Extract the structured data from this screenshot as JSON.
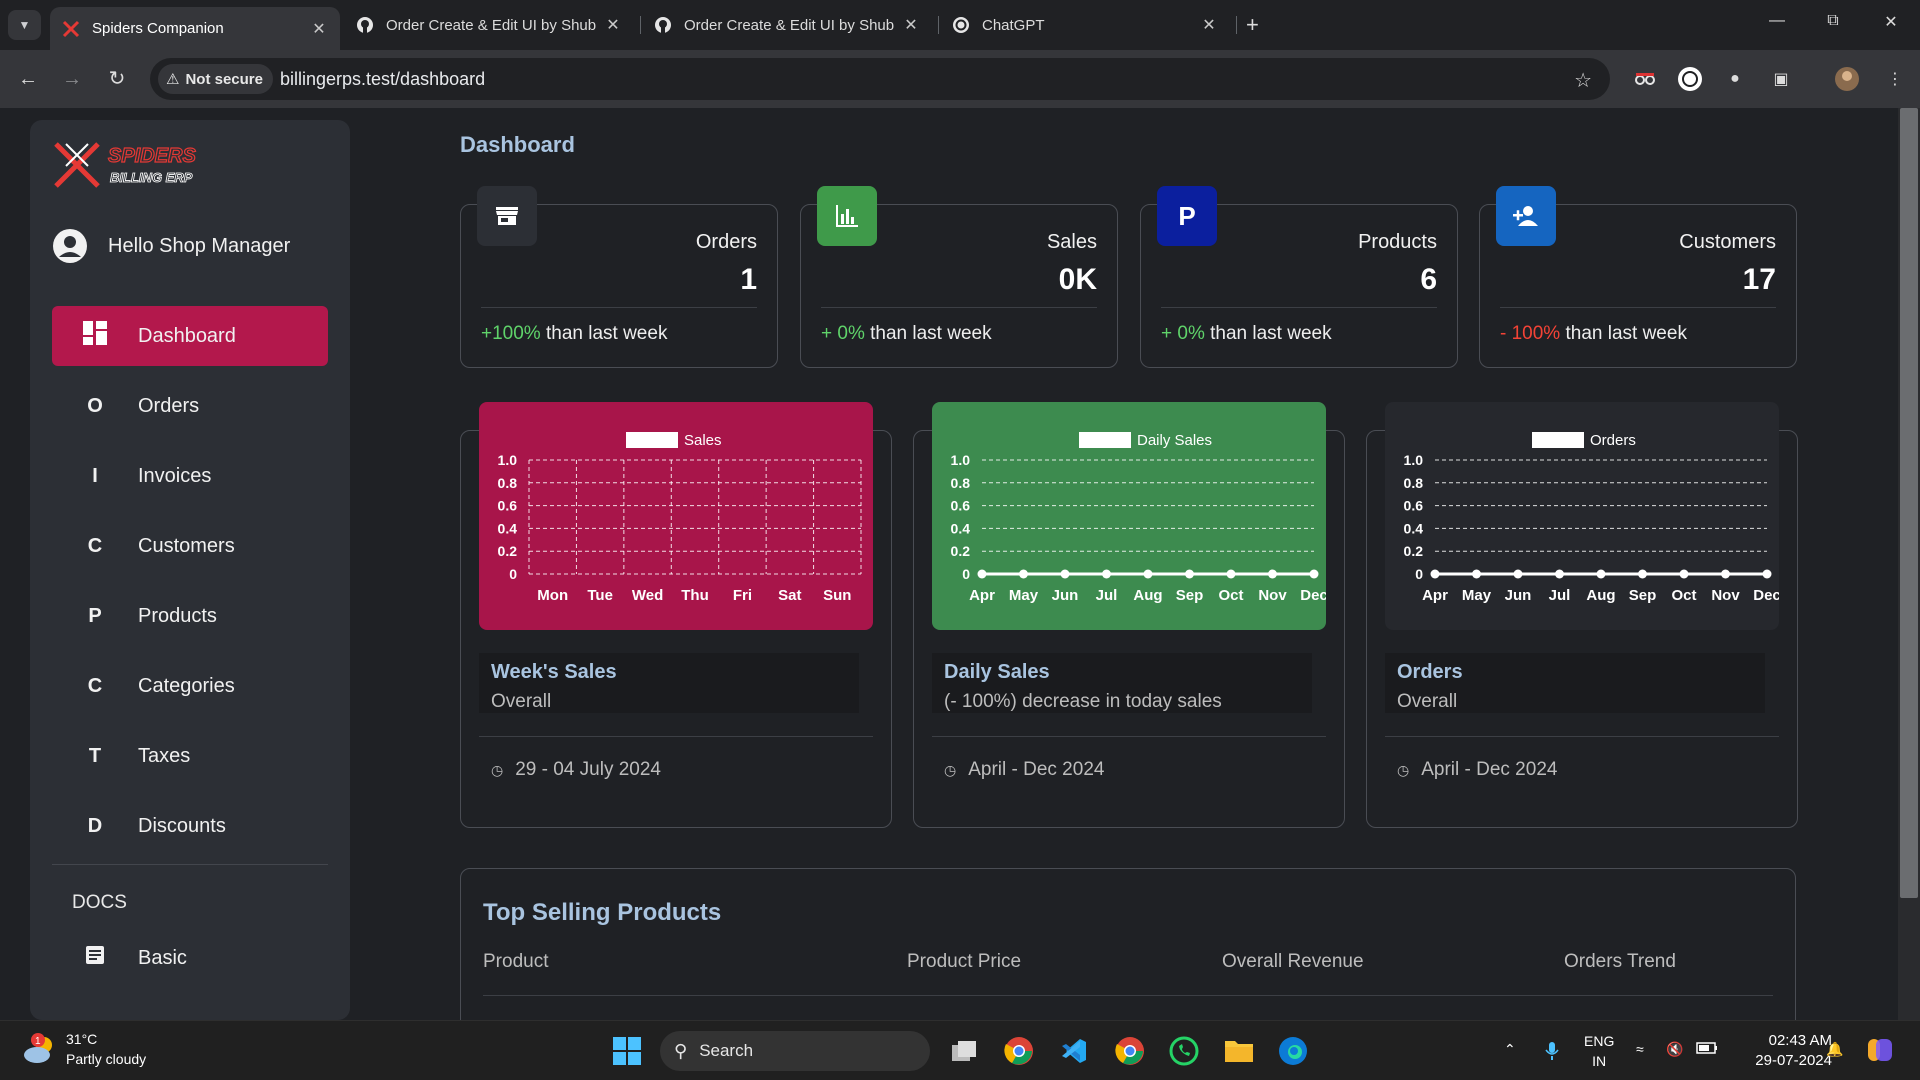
{
  "browser": {
    "tabs": [
      {
        "title": "Spiders Companion",
        "active": true,
        "icon": "spiders-favicon"
      },
      {
        "title": "Order Create & Edit UI by Shub",
        "active": false,
        "icon": "github-icon"
      },
      {
        "title": "Order Create & Edit UI by Shub",
        "active": false,
        "icon": "github-icon"
      },
      {
        "title": "ChatGPT",
        "active": false,
        "icon": "chatgpt-icon"
      }
    ],
    "security_label": "Not secure",
    "url": "billingerps.test/dashboard"
  },
  "sidebar": {
    "greeting": "Hello Shop Manager",
    "items": [
      {
        "icon": "dashboard-icon",
        "label": "Dashboard",
        "active": true
      },
      {
        "letter": "O",
        "label": "Orders"
      },
      {
        "letter": "I",
        "label": "Invoices"
      },
      {
        "letter": "C",
        "label": "Customers"
      },
      {
        "letter": "P",
        "label": "Products"
      },
      {
        "letter": "C",
        "label": "Categories"
      },
      {
        "letter": "T",
        "label": "Taxes"
      },
      {
        "letter": "D",
        "label": "Discounts"
      }
    ],
    "docs_heading": "DOCS",
    "docs_items": [
      {
        "icon": "document-icon",
        "label": "Basic"
      }
    ]
  },
  "main": {
    "title": "Dashboard",
    "stats": [
      {
        "label": "Orders",
        "value": "1",
        "change": "+100%",
        "suffix": " than last week",
        "trend": "pos",
        "badge_color": "#2c2f35",
        "icon": "store-icon"
      },
      {
        "label": "Sales",
        "value": "0K",
        "change": "+ 0%",
        "suffix": " than last week",
        "trend": "pos",
        "badge_color": "#3f9a4a",
        "icon": "bar-chart-icon"
      },
      {
        "label": "Products",
        "value": "6",
        "change": "+ 0%",
        "suffix": " than last week",
        "trend": "pos",
        "badge_color": "#0b1f9e",
        "badge_letter": "P"
      },
      {
        "label": "Customers",
        "value": "17",
        "change": "- 100%",
        "suffix": " than last week",
        "trend": "neg",
        "badge_color": "#1565c0",
        "icon": "person-add-icon"
      }
    ],
    "charts": [
      {
        "title": "Week's Sales",
        "subtitle": "Overall",
        "footer": "29 - 04 July 2024"
      },
      {
        "title": "Daily Sales",
        "subtitle": "(- 100%) decrease in today sales",
        "footer": "April - Dec 2024"
      },
      {
        "title": "Orders",
        "subtitle": "Overall",
        "footer": "April - Dec 2024"
      }
    ],
    "top_selling": {
      "title": "Top Selling Products",
      "columns": [
        "Product",
        "Product Price",
        "Overall Revenue",
        "Orders Trend"
      ]
    }
  },
  "chart_data": [
    {
      "type": "bar",
      "legend": [
        "Sales"
      ],
      "categories": [
        "Mon",
        "Tue",
        "Wed",
        "Thu",
        "Fri",
        "Sat",
        "Sun"
      ],
      "series": [
        {
          "name": "Sales",
          "values": [
            0,
            0,
            0,
            0,
            0,
            0,
            0
          ]
        }
      ],
      "yticks": [
        "1.0",
        "0.8",
        "0.6",
        "0.4",
        "0.2",
        "0"
      ],
      "ylim": [
        0,
        1
      ],
      "bg": "#a8154a"
    },
    {
      "type": "line",
      "legend": [
        "Daily Sales"
      ],
      "categories": [
        "Apr",
        "May",
        "Jun",
        "Jul",
        "Aug",
        "Sep",
        "Oct",
        "Nov",
        "Dec"
      ],
      "series": [
        {
          "name": "Daily Sales",
          "values": [
            0,
            0,
            0,
            0,
            0,
            0,
            0,
            0,
            0
          ]
        }
      ],
      "yticks": [
        "1.0",
        "0.8",
        "0.6",
        "0.4",
        "0.2",
        "0"
      ],
      "ylim": [
        0,
        1
      ],
      "bg": "#3d8b4f"
    },
    {
      "type": "line",
      "legend": [
        "Orders"
      ],
      "categories": [
        "Apr",
        "May",
        "Jun",
        "Jul",
        "Aug",
        "Sep",
        "Oct",
        "Nov",
        "Dec"
      ],
      "series": [
        {
          "name": "Orders",
          "values": [
            0,
            0,
            0,
            0,
            0,
            0,
            0,
            0,
            0
          ]
        }
      ],
      "yticks": [
        "1.0",
        "0.8",
        "0.6",
        "0.4",
        "0.2",
        "0"
      ],
      "ylim": [
        0,
        1
      ],
      "bg": "#26282d"
    }
  ],
  "taskbar": {
    "weather_temp": "31°C",
    "weather_desc": "Partly cloudy",
    "weather_alert": "1",
    "search_label": "Search",
    "lang_top": "ENG",
    "lang_bottom": "IN",
    "time": "02:43 AM",
    "date": "29-07-2024"
  }
}
